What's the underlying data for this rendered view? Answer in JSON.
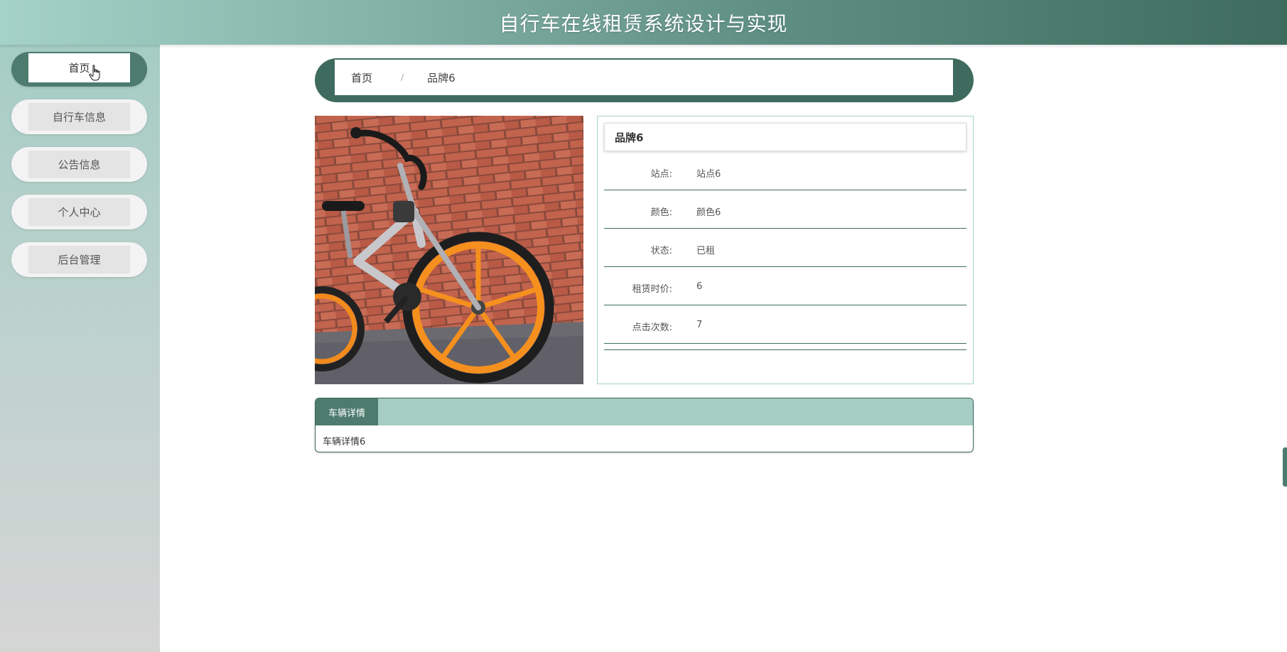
{
  "header": {
    "title": "自行车在线租赁系统设计与实现"
  },
  "sidebar": {
    "items": [
      {
        "label": "首页",
        "active": true
      },
      {
        "label": "自行车信息",
        "active": false
      },
      {
        "label": "公告信息",
        "active": false
      },
      {
        "label": "个人中心",
        "active": false
      },
      {
        "label": "后台管理",
        "active": false
      }
    ]
  },
  "breadcrumb": {
    "home": "首页",
    "separator": "/",
    "current": "品牌6"
  },
  "detail": {
    "name": "品牌6",
    "fields": [
      {
        "label": "站点:",
        "value": "站点6"
      },
      {
        "label": "颜色:",
        "value": "颜色6"
      },
      {
        "label": "状态:",
        "value": "已租"
      },
      {
        "label": "租赁时价:",
        "value": "6"
      },
      {
        "label": "点击次数:",
        "value": "7"
      }
    ]
  },
  "tabs": {
    "active_label": "车辆详情",
    "content": "车辆详情6"
  },
  "colors": {
    "accent_dark": "#3e6b5e",
    "accent_mid": "#4d7b6e",
    "accent_light": "#a5cdc4"
  }
}
